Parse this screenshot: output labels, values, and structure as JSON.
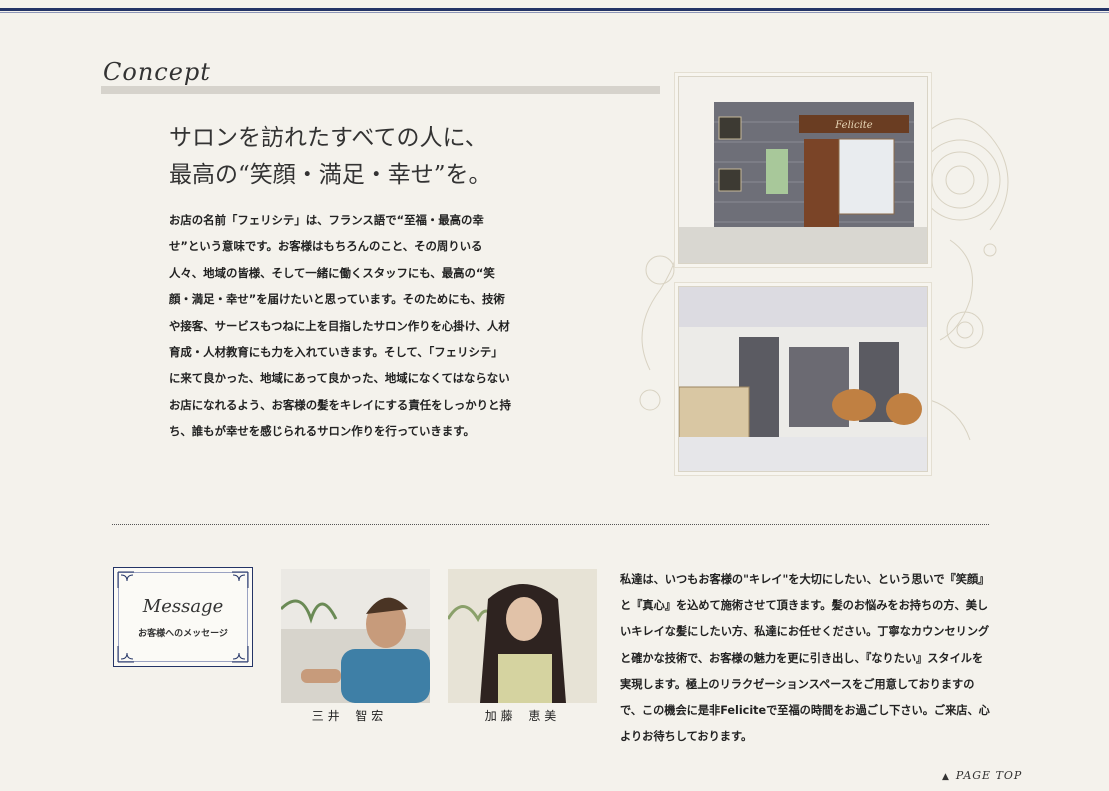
{
  "concept": {
    "heading": "Concept",
    "tagline": [
      "サロンを訪れたすべての人に、",
      "最高の“笑顔・満足・幸せ”を。"
    ],
    "body": "お店の名前「フェリシテ」は、フランス語で“至福・最高の幸せ”という意味です。お客様はもちろんのこと、その周りいる人々、地域の皆様、そして一緒に働くスタッフにも、最高の“笑顔・満足・幸せ”を届けたいと思っています。そのためにも、技術や接客、サービスもつねに上を目指したサロン作りを心掛け、人材育成・人材教育にも力を入れていきます。そして、「フェリシテ」に来て良かった、地域にあって良かった、地域になくてはならないお店になれるよう、お客様の髪をキレイにする責任をしっかりと持ち、誰もが幸せを感じられるサロン作りを行っていきます。",
    "sign_text": "Felicite"
  },
  "message": {
    "box_title": "Message",
    "box_subtitle": "お客様へのメッセージ",
    "staff": [
      {
        "name": "三 井　 智 宏"
      },
      {
        "name": "加 藤　 恵 美"
      }
    ],
    "body": "私達は、いつもお客様の\"キレイ\"を大切にしたい、という思いで『笑顔』と『真心』を込めて施術させて頂きます。髪のお悩みをお持ちの方、美しいキレイな髪にしたい方、私達にお任せください。丁寧なカウンセリングと確かな技術で、お客様の魅力を更に引き出し、『なりたい』スタイルを実現します。極上のリラクゼーションスペースをご用意しておりますので、この機会に是非Feliciteで至福の時間をお過ごし下さい。ご来店、心よりお待ちしております。"
  },
  "page_top": {
    "label": "PAGE TOP",
    "icon": "triangle-up-icon"
  },
  "colors": {
    "navy": "#243466",
    "background": "#f4f2ec",
    "rule": "#d6d3cc"
  }
}
